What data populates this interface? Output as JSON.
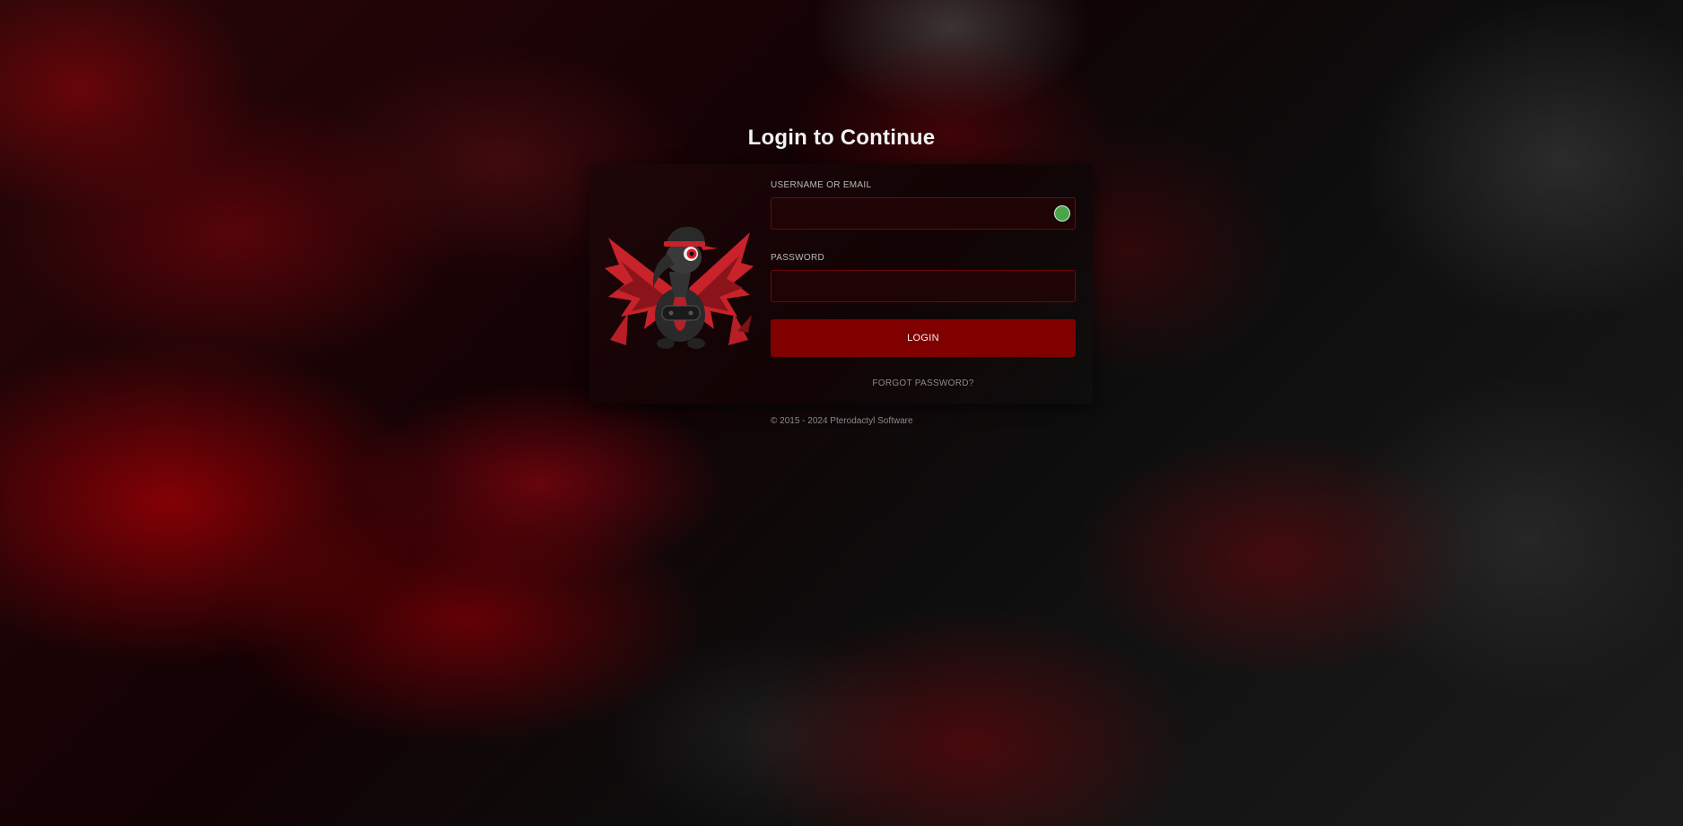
{
  "page": {
    "title": "Login to Continue"
  },
  "form": {
    "username_label": "USERNAME OR EMAIL",
    "username_value": "",
    "password_label": "PASSWORD",
    "password_value": "",
    "login_label": "LOGIN",
    "forgot_label": "FORGOT PASSWORD?"
  },
  "footer": {
    "copyright": "© 2015 - 2024 Pterodactyl Software"
  },
  "icons": {
    "mascot": "pterodactyl-gamer-mascot",
    "field_extension": "password-manager-icon"
  },
  "colors": {
    "accent": "#800000",
    "input_border": "#6a0a0d",
    "input_bg": "#1e0405",
    "extension_icon": "#4aa54a"
  }
}
